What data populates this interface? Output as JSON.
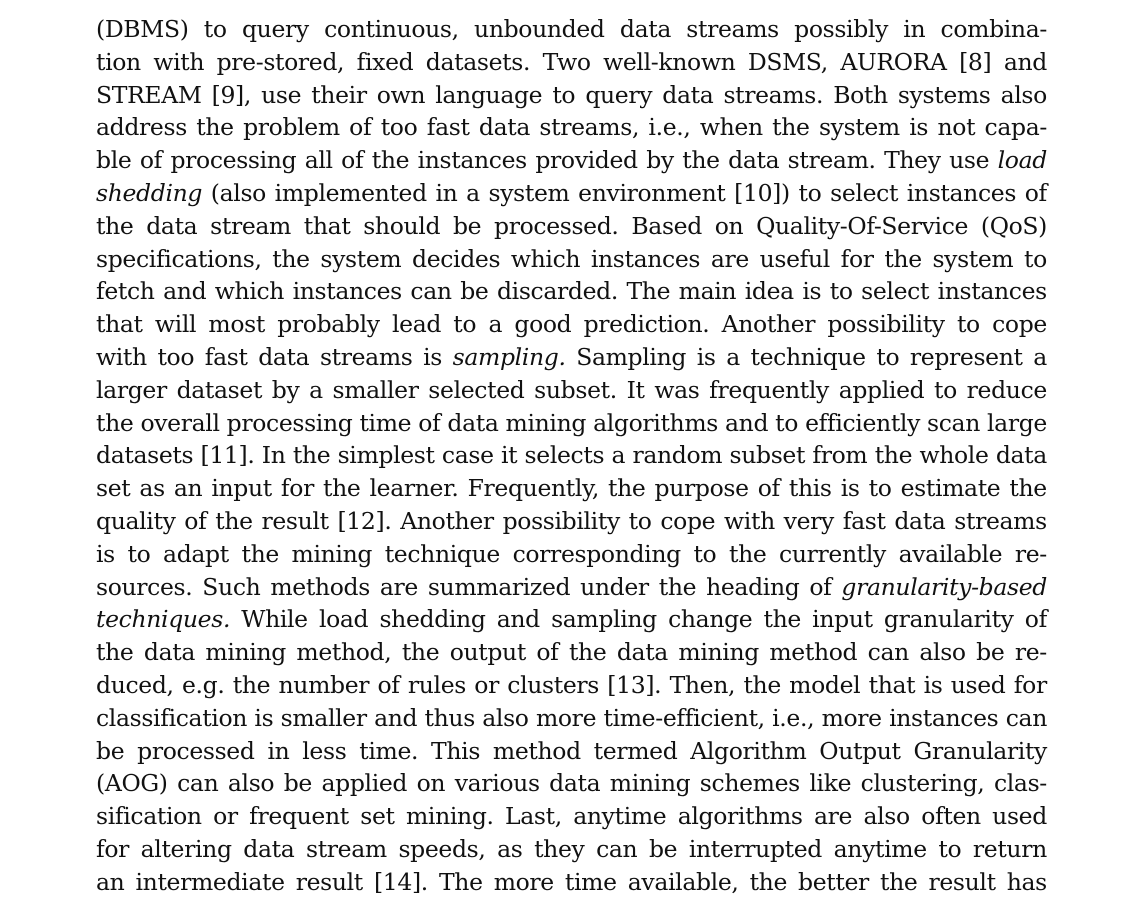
{
  "paper": {
    "lines": [
      "(DBMS) to query continuous, unbounded data streams possibly in combina-",
      "tion with pre-stored, fixed datasets. Two well-known DSMS, AURORA [8] and",
      "STREAM [9], use their own language to query data streams. Both systems also",
      "address the problem of too fast data streams, i.e., when the system is not capa-",
      "ble of processing all of the instances provided by the data stream. They use *load*",
      "*shedding* (also implemented in a system environment [10]) to select instances of",
      "the data stream that should be processed. Based on Quality-Of-Service (QoS)",
      "specifications, the system decides which instances are useful for the system to",
      "fetch and which instances can be discarded. The main idea is to select instances",
      "that will most probably lead to a good prediction. Another possibility to cope",
      "with too fast data streams is *sampling.* Sampling is a technique to represent a",
      "larger dataset by a smaller selected subset. It was frequently applied to reduce",
      "the overall processing time of data mining algorithms and to efficiently scan large",
      "datasets [11]. In the simplest case it selects a random subset from the whole data",
      "set as an input for the learner. Frequently, the purpose of this is to estimate the",
      "quality of the result [12]. Another possibility to cope with very fast data streams",
      "is to adapt the mining technique corresponding to the currently available re-",
      "sources. Such methods are summarized under the heading of *granularity-based*",
      "*techniques.* While load shedding and sampling change the input granularity of",
      "the data mining method, the output of the data mining method can also be re-",
      "duced, e.g. the number of rules or clusters [13]. Then, the model that is used for",
      "classification is smaller and thus also more time-efficient, i.e., more instances can",
      "be processed in less time. This method termed Algorithm Output Granularity",
      "(AOG) can also be applied on various data mining schemes like clustering, clas-",
      "sification or frequent set mining. Last, anytime algorithms are also often used",
      "for altering data stream speeds, as they can be interrupted anytime to return",
      "an intermediate result [14]. The more time available, the better the result has"
    ]
  }
}
